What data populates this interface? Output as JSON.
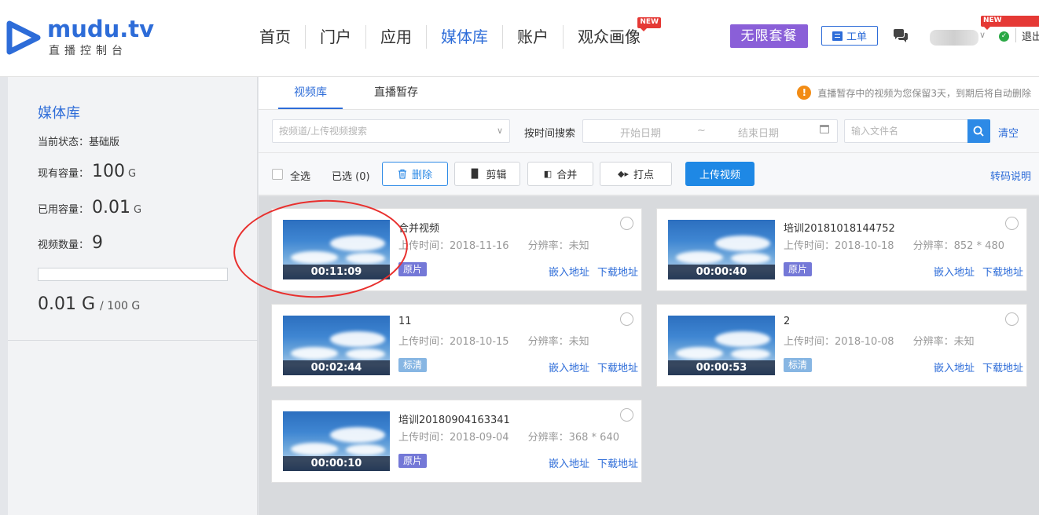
{
  "header": {
    "logo_name": "mudu.tv",
    "logo_sub": "直播控制台",
    "nav": [
      {
        "label": "首页",
        "active": false,
        "is_new": false
      },
      {
        "label": "门户",
        "active": false,
        "is_new": false
      },
      {
        "label": "应用",
        "active": false,
        "is_new": false
      },
      {
        "label": "媒体库",
        "active": true,
        "is_new": false
      },
      {
        "label": "账户",
        "active": false,
        "is_new": false
      },
      {
        "label": "观众画像",
        "active": false,
        "is_new": true
      }
    ],
    "new_badge": "NEW",
    "unlimited_label": "无限套餐",
    "ticket_label": "工单",
    "logout_label": "退出"
  },
  "sidebar": {
    "title": "媒体库",
    "status_label": "当前状态：",
    "status_value": "基础版",
    "capacity_label": "现有容量：",
    "capacity_value": "100",
    "capacity_unit": "G",
    "used_label": "已用容量：",
    "used_value": "0.01",
    "used_unit": "G",
    "count_label": "视频数量：",
    "count_value": "9",
    "usage_fraction": 0.0001,
    "total_used": "0.01 G",
    "total_cap": "/ 100 G"
  },
  "tabs": [
    {
      "label": "视频库",
      "active": true
    },
    {
      "label": "直播暂存",
      "active": false
    }
  ],
  "notice": "直播暂存中的视频为您保留3天，到期后将自动删除",
  "filters": {
    "channel_placeholder": "按频道/上传视频搜索",
    "time_label": "按时间搜索",
    "start_placeholder": "开始日期",
    "range_sep": "~",
    "end_placeholder": "结束日期",
    "file_placeholder": "输入文件名",
    "clear_label": "清空"
  },
  "actions": {
    "select_all": "全选",
    "selected": "已选 (0)",
    "delete": "删除",
    "clip": "剪辑",
    "merge": "合并",
    "mark": "打点",
    "upload": "上传视频",
    "transcode_help": "转码说明"
  },
  "card_labels": {
    "upload_time": "上传时间：",
    "resolution": "分辨率：",
    "embed": "嵌入地址",
    "download": "下载地址"
  },
  "videos": [
    {
      "title": "合并视频",
      "date": "2018-11-16",
      "resolution": "未知",
      "duration": "00:11:09",
      "quality": "原片"
    },
    {
      "title": "培训20181018144752",
      "date": "2018-10-18",
      "resolution": "852 * 480",
      "duration": "00:00:40",
      "quality": "原片"
    },
    {
      "title": "11",
      "date": "2018-10-15",
      "resolution": "未知",
      "duration": "00:02:44",
      "quality": "标清"
    },
    {
      "title": "2",
      "date": "2018-10-08",
      "resolution": "未知",
      "duration": "00:00:53",
      "quality": "标清"
    },
    {
      "title": "培训20180904163341",
      "date": "2018-09-04",
      "resolution": "368 * 640",
      "duration": "00:00:10",
      "quality": "原片"
    }
  ],
  "colors": {
    "accent": "#2d6cd8",
    "purple": "#8a5fd8",
    "primary_button": "#1e88e5",
    "annotation": "#e8302e"
  }
}
